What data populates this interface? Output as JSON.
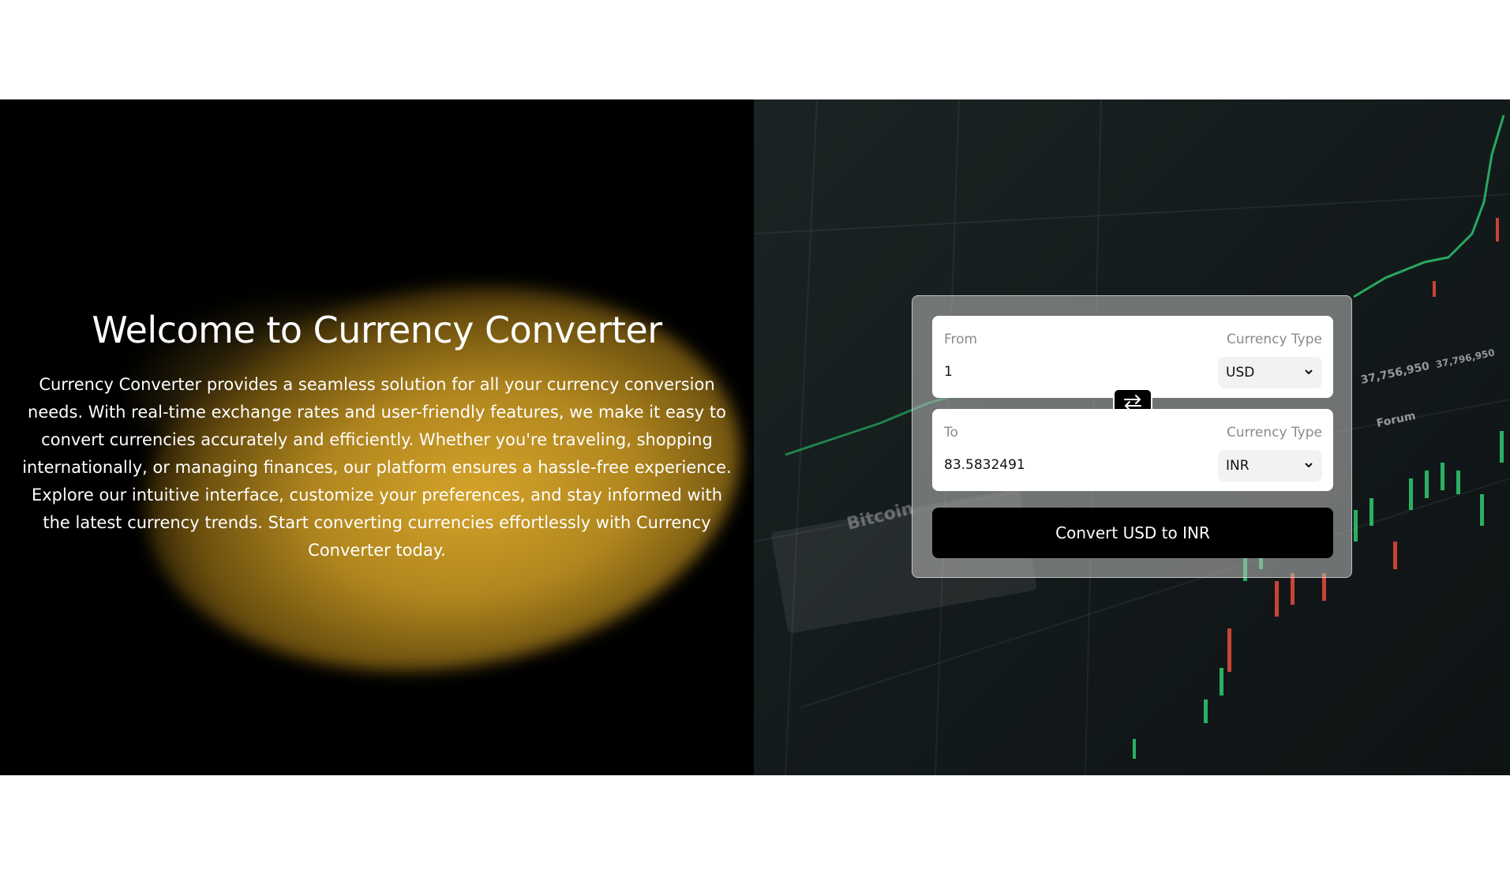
{
  "hero": {
    "title": "Welcome to Currency Converter",
    "description": "Currency Converter provides a seamless solution for all your currency conversion needs. With real-time exchange rates and user-friendly features, we make it easy to convert currencies accurately and efficiently. Whether you're traveling, shopping internationally, or managing finances, our platform ensures a hassle-free experience. Explore our intuitive interface, customize your preferences, and stay informed with the latest currency trends. Start converting currencies effortlessly with Currency Converter today."
  },
  "converter": {
    "from": {
      "label": "From",
      "type_label": "Currency Type",
      "amount": "1",
      "currency": "USD"
    },
    "to": {
      "label": "To",
      "type_label": "Currency Type",
      "amount": "83.5832491",
      "currency": "INR"
    },
    "swap_icon": "swap-arrows-icon",
    "convert_label": "Convert USD to INR"
  },
  "background_text": {
    "price_1": "37,756,950",
    "price_2": "37,796,950",
    "forum": "Forum",
    "bitcoin": "Bitcoin"
  },
  "colors": {
    "button": "#000000",
    "candle_up": "#2ecc71",
    "candle_down": "#e74c3c"
  }
}
